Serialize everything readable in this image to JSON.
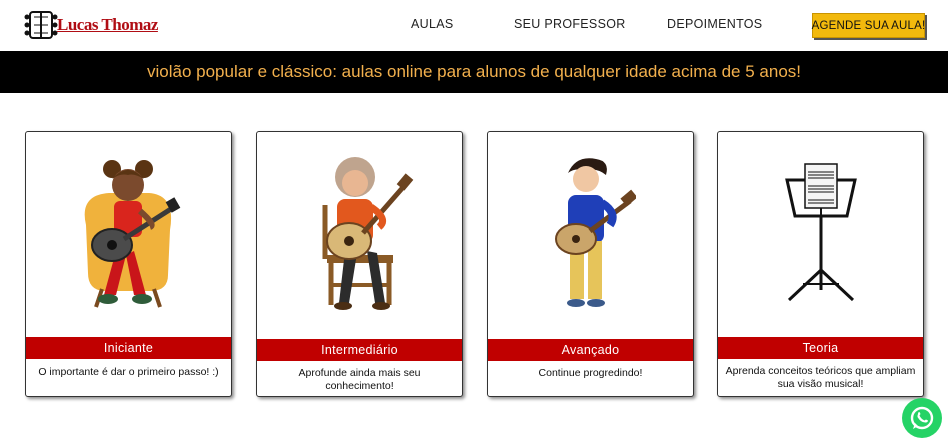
{
  "header": {
    "logo_text": "Lucas Thomaz",
    "nav": [
      "AULAS",
      "SEU PROFESSOR",
      "DEPOIMENTOS"
    ],
    "cta_label": "AGENDE SUA AULA!"
  },
  "banner": {
    "text": "violão popular e clássico: aulas online para alunos de qualquer idade acima de 5 anos!"
  },
  "cards": [
    {
      "title": "Iniciante",
      "description": "O importante é dar o primeiro passo! :)",
      "icon": "child-guitar-icon"
    },
    {
      "title": "Intermediário",
      "description": "Aprofunde ainda mais seu conhecimento!",
      "icon": "grandma-guitar-icon"
    },
    {
      "title": "Avançado",
      "description": "Continue progredindo!",
      "icon": "boy-guitar-icon"
    },
    {
      "title": "Teoria",
      "description": "Aprenda conceitos teóricos que ampliam sua visão musical!",
      "icon": "music-stand-icon"
    }
  ],
  "colors": {
    "accent_red": "#c00000",
    "cta_yellow": "#f2b90d",
    "banner_text": "#f2b04d",
    "whatsapp_green": "#25d366"
  },
  "floating": {
    "icon": "whatsapp-icon"
  }
}
